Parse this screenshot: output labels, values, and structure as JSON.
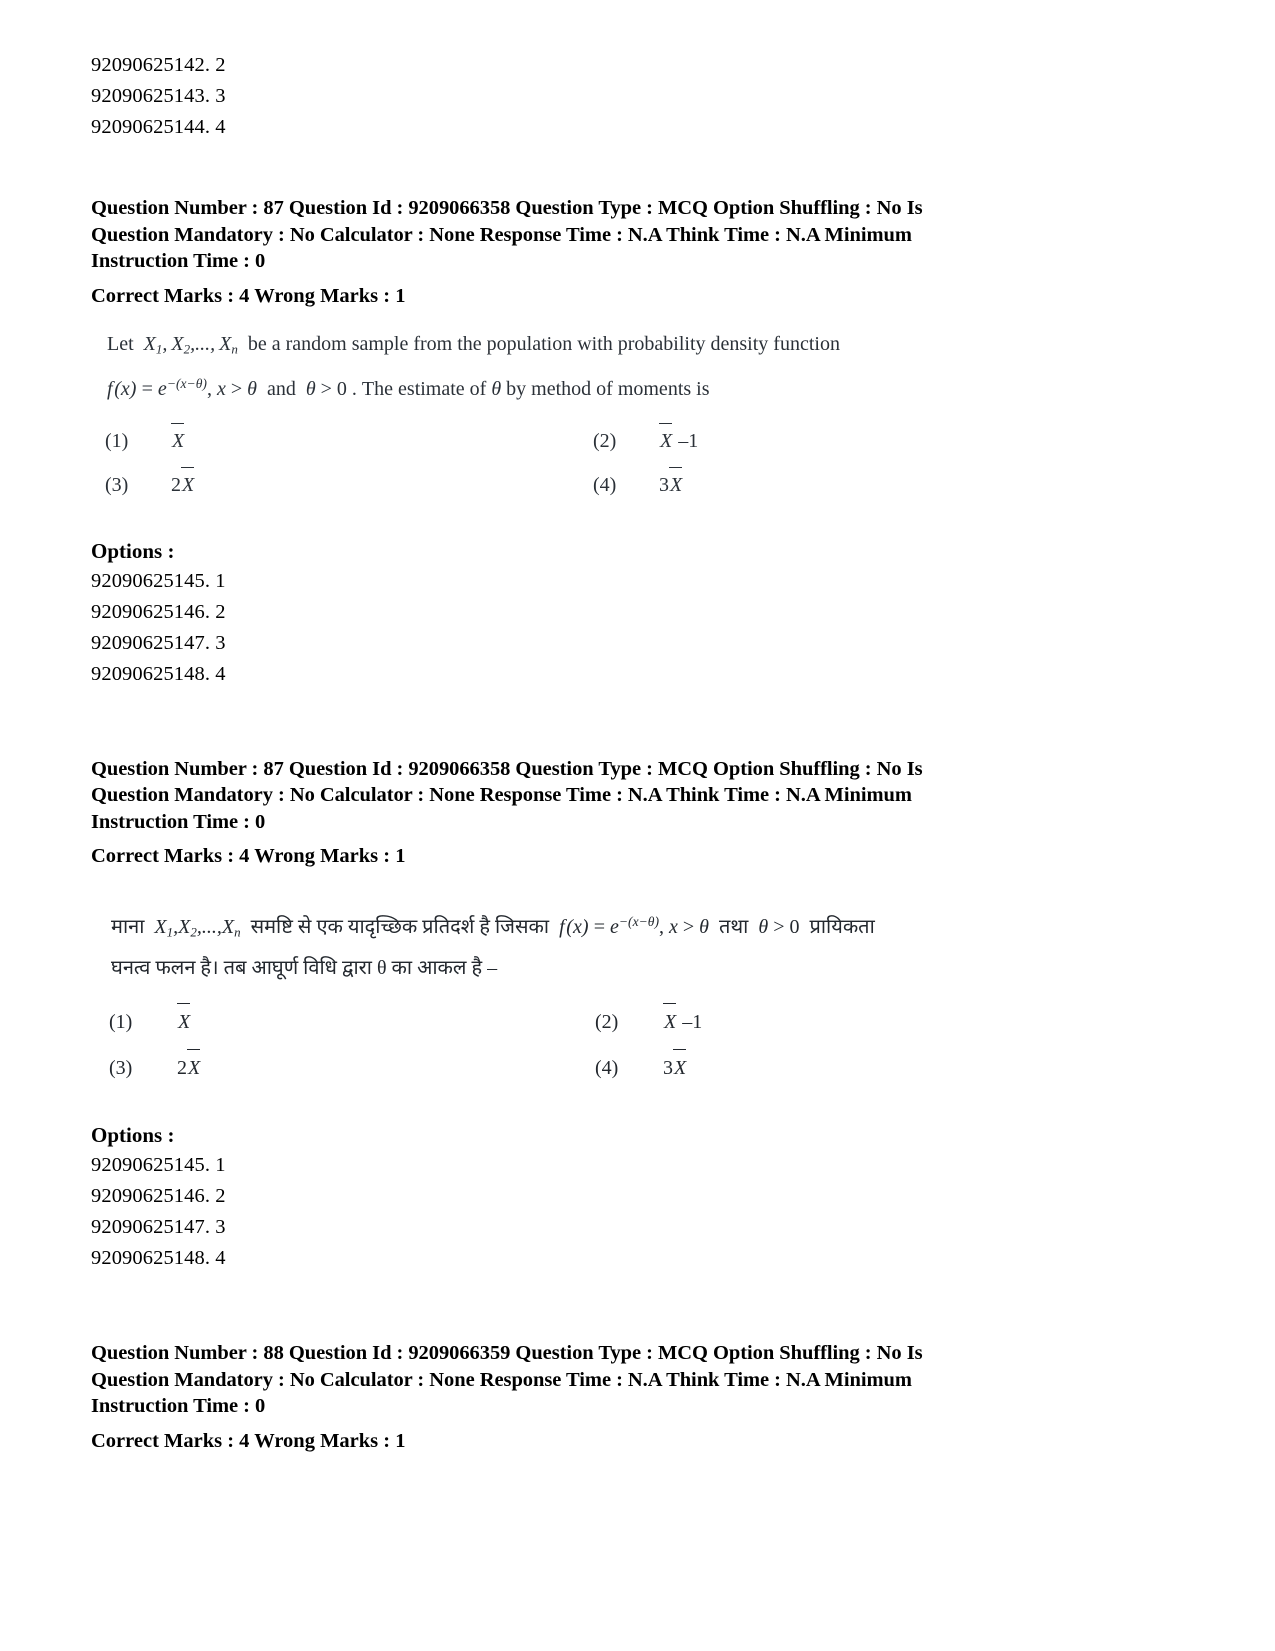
{
  "page": {
    "top_option_ids": [
      "92090625142. 2",
      "92090625143. 3",
      "92090625144. 4"
    ]
  },
  "question_87_en": {
    "header_line1": "Question Number : 87 Question Id : 9209066358 Question Type : MCQ Option Shuffling : No Is",
    "header_line2": "Question Mandatory : No Calculator : None Response Time : N.A Think Time : N.A Minimum",
    "header_line3": "Instruction Time : 0",
    "marks": "Correct Marks : 4 Wrong Marks : 1",
    "body_line1_pre": "Let",
    "body_line1_vars": "X1, X2,..., Xn",
    "body_line1_post": "be a random sample from the population with probability density function",
    "body_line2": "f (x) = e-(x-θ) , x > θ and θ > 0 . The estimate of θ by method of moments is",
    "options": [
      {
        "num": "(1)",
        "value": "X̄"
      },
      {
        "num": "(2)",
        "value": "X̄ – 1"
      },
      {
        "num": "(3)",
        "value": "2X̄"
      },
      {
        "num": "(4)",
        "value": "3X̄"
      }
    ],
    "options_label": "Options :",
    "option_ids": [
      "92090625145. 1",
      "92090625146. 2",
      "92090625147. 3",
      "92090625148. 4"
    ]
  },
  "question_87_hi": {
    "header_line1": "Question Number : 87 Question Id : 9209066358 Question Type : MCQ Option Shuffling : No Is",
    "header_line2": "Question Mandatory : No Calculator : None Response Time : N.A Think Time : N.A Minimum",
    "header_line3": "Instruction Time : 0",
    "marks": "Correct Marks : 4 Wrong Marks : 1",
    "body_line1_pre": "माना",
    "body_line1_vars": "X1, X2,..., Xn",
    "body_line1_mid": "समष्टि से एक यादृच्छिक प्रतिदर्श है जिसका",
    "body_line1_formula": "f (x) = e-(x-θ) , x > θ",
    "body_line1_tail": "तथा",
    "body_line1_cond": "θ > 0",
    "body_line1_end": "प्रायिकता",
    "body_line2": "घनत्व फलन है। तब आघूर्ण विधि द्वारा θ का आकल है –",
    "options": [
      {
        "num": "(1)",
        "value": "X̄"
      },
      {
        "num": "(2)",
        "value": "X̄ – 1"
      },
      {
        "num": "(3)",
        "value": "2X̄"
      },
      {
        "num": "(4)",
        "value": "3X̄"
      }
    ],
    "options_label": "Options :",
    "option_ids": [
      "92090625145. 1",
      "92090625146. 2",
      "92090625147. 3",
      "92090625148. 4"
    ]
  },
  "question_88": {
    "header_line1": "Question Number : 88 Question Id : 9209066359 Question Type : MCQ Option Shuffling : No Is",
    "header_line2": "Question Mandatory : No Calculator : None Response Time : N.A Think Time : N.A Minimum",
    "header_line3": "Instruction Time : 0",
    "marks": "Correct Marks : 4 Wrong Marks : 1"
  }
}
